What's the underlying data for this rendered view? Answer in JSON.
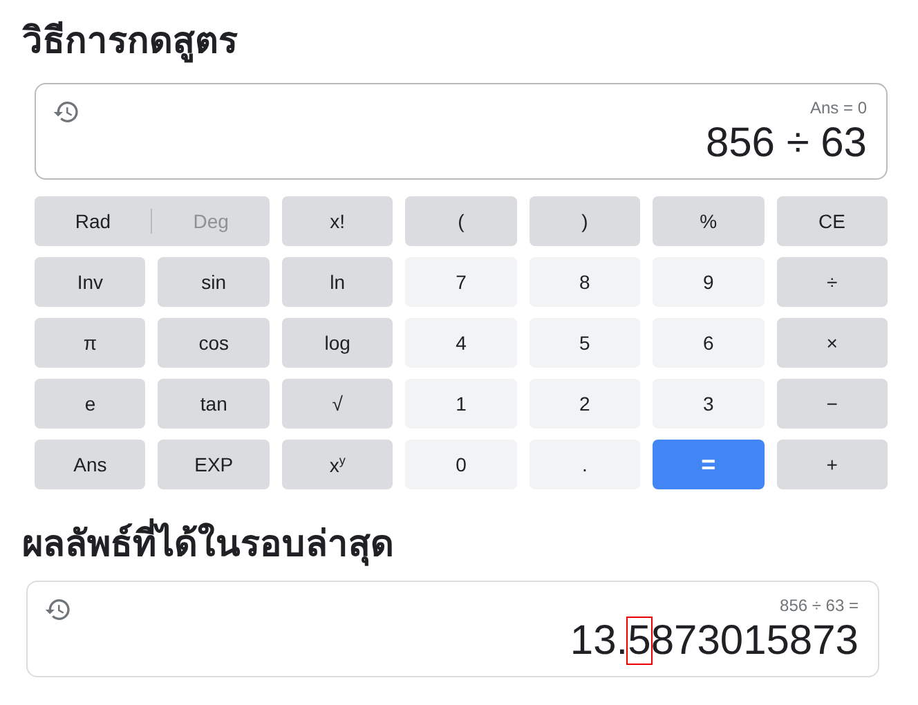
{
  "calculator": {
    "heading": "วิธีการกดสูตร",
    "display": {
      "memory": "Ans = 0",
      "expression": "856 ÷ 63"
    },
    "keys": [
      {
        "kind": "mode",
        "options": [
          {
            "label": "Rad",
            "selected": true
          },
          {
            "label": "Deg",
            "selected": false
          }
        ]
      },
      {
        "kind": "func",
        "label": "x!"
      },
      {
        "kind": "func",
        "label": "("
      },
      {
        "kind": "func",
        "label": ")"
      },
      {
        "kind": "func",
        "label": "%"
      },
      {
        "kind": "func",
        "label": "CE"
      },
      {
        "kind": "func",
        "label": "Inv"
      },
      {
        "kind": "func",
        "label": "sin"
      },
      {
        "kind": "func",
        "label": "ln"
      },
      {
        "kind": "num",
        "label": "7"
      },
      {
        "kind": "num",
        "label": "8"
      },
      {
        "kind": "num",
        "label": "9"
      },
      {
        "kind": "func",
        "label": "÷"
      },
      {
        "kind": "func",
        "label": "π"
      },
      {
        "kind": "func",
        "label": "cos"
      },
      {
        "kind": "func",
        "label": "log"
      },
      {
        "kind": "num",
        "label": "4"
      },
      {
        "kind": "num",
        "label": "5"
      },
      {
        "kind": "num",
        "label": "6"
      },
      {
        "kind": "func",
        "label": "×"
      },
      {
        "kind": "func",
        "label": "e"
      },
      {
        "kind": "func",
        "label": "tan"
      },
      {
        "kind": "func",
        "label": "√"
      },
      {
        "kind": "num",
        "label": "1"
      },
      {
        "kind": "num",
        "label": "2"
      },
      {
        "kind": "num",
        "label": "3"
      },
      {
        "kind": "func",
        "label": "−"
      },
      {
        "kind": "func",
        "label": "Ans"
      },
      {
        "kind": "func",
        "label": "EXP"
      },
      {
        "kind": "func",
        "label": "x$^{y}$"
      },
      {
        "kind": "num",
        "label": "0"
      },
      {
        "kind": "num",
        "label": "."
      },
      {
        "kind": "equals",
        "label": "="
      },
      {
        "kind": "func",
        "label": "+"
      }
    ]
  },
  "latest": {
    "heading": "ผลลัพธ์ที่ได้ในรอบล่าสุด",
    "expression": "856 ÷ 63 =",
    "result": {
      "before": "13.",
      "highlighted": "5",
      "after": "873015873"
    }
  }
}
